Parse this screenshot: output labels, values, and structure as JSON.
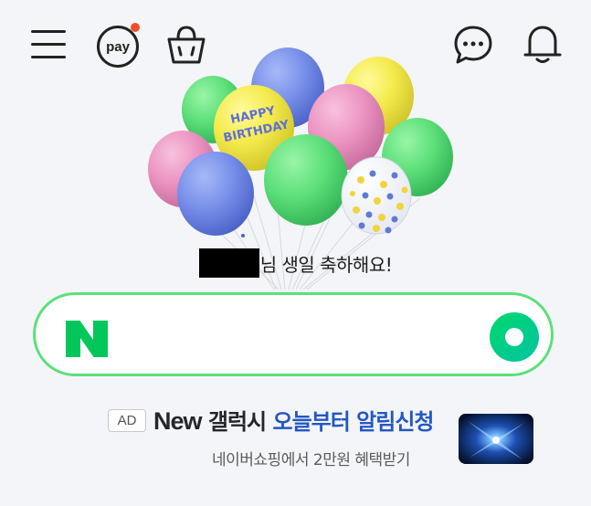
{
  "topbar": {
    "menu_icon": "hamburger-menu-icon",
    "pay_label": "pay",
    "pay_badge_color": "#f04e2b",
    "bag_icon": "shopping-bag-icon",
    "chat_icon": "chat-bubble-icon",
    "bell_icon": "bell-icon"
  },
  "birthday": {
    "balloon_text_line1": "HAPPY",
    "balloon_text_line2": "BIRTHDAY",
    "message": "님 생일 축하해요!"
  },
  "search": {
    "logo_letter": "N",
    "placeholder": "",
    "accent_color": "#03c75a"
  },
  "ad": {
    "badge": "AD",
    "brand": "New",
    "product": "갤럭시",
    "headline_highlight": "오늘부터 알림신청",
    "subtitle": "네이버쇼핑에서 2만원 혜택받기"
  }
}
